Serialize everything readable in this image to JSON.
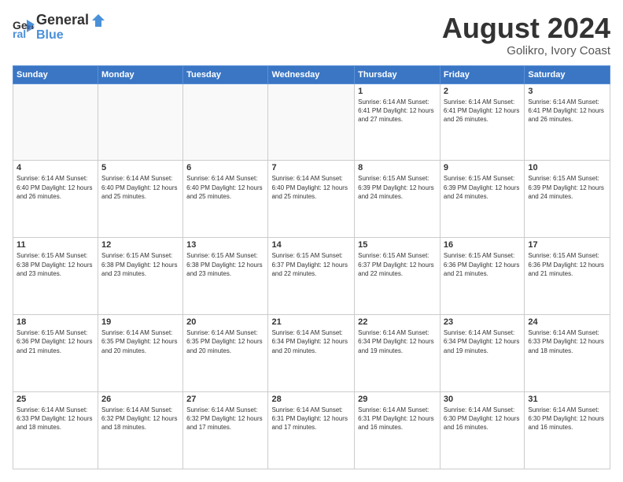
{
  "header": {
    "logo_line1": "General",
    "logo_line2": "Blue",
    "month_title": "August 2024",
    "location": "Golikro, Ivory Coast"
  },
  "days_of_week": [
    "Sunday",
    "Monday",
    "Tuesday",
    "Wednesday",
    "Thursday",
    "Friday",
    "Saturday"
  ],
  "weeks": [
    [
      {
        "day": "",
        "info": ""
      },
      {
        "day": "",
        "info": ""
      },
      {
        "day": "",
        "info": ""
      },
      {
        "day": "",
        "info": ""
      },
      {
        "day": "1",
        "info": "Sunrise: 6:14 AM\nSunset: 6:41 PM\nDaylight: 12 hours\nand 27 minutes."
      },
      {
        "day": "2",
        "info": "Sunrise: 6:14 AM\nSunset: 6:41 PM\nDaylight: 12 hours\nand 26 minutes."
      },
      {
        "day": "3",
        "info": "Sunrise: 6:14 AM\nSunset: 6:41 PM\nDaylight: 12 hours\nand 26 minutes."
      }
    ],
    [
      {
        "day": "4",
        "info": "Sunrise: 6:14 AM\nSunset: 6:40 PM\nDaylight: 12 hours\nand 26 minutes."
      },
      {
        "day": "5",
        "info": "Sunrise: 6:14 AM\nSunset: 6:40 PM\nDaylight: 12 hours\nand 25 minutes."
      },
      {
        "day": "6",
        "info": "Sunrise: 6:14 AM\nSunset: 6:40 PM\nDaylight: 12 hours\nand 25 minutes."
      },
      {
        "day": "7",
        "info": "Sunrise: 6:14 AM\nSunset: 6:40 PM\nDaylight: 12 hours\nand 25 minutes."
      },
      {
        "day": "8",
        "info": "Sunrise: 6:15 AM\nSunset: 6:39 PM\nDaylight: 12 hours\nand 24 minutes."
      },
      {
        "day": "9",
        "info": "Sunrise: 6:15 AM\nSunset: 6:39 PM\nDaylight: 12 hours\nand 24 minutes."
      },
      {
        "day": "10",
        "info": "Sunrise: 6:15 AM\nSunset: 6:39 PM\nDaylight: 12 hours\nand 24 minutes."
      }
    ],
    [
      {
        "day": "11",
        "info": "Sunrise: 6:15 AM\nSunset: 6:38 PM\nDaylight: 12 hours\nand 23 minutes."
      },
      {
        "day": "12",
        "info": "Sunrise: 6:15 AM\nSunset: 6:38 PM\nDaylight: 12 hours\nand 23 minutes."
      },
      {
        "day": "13",
        "info": "Sunrise: 6:15 AM\nSunset: 6:38 PM\nDaylight: 12 hours\nand 23 minutes."
      },
      {
        "day": "14",
        "info": "Sunrise: 6:15 AM\nSunset: 6:37 PM\nDaylight: 12 hours\nand 22 minutes."
      },
      {
        "day": "15",
        "info": "Sunrise: 6:15 AM\nSunset: 6:37 PM\nDaylight: 12 hours\nand 22 minutes."
      },
      {
        "day": "16",
        "info": "Sunrise: 6:15 AM\nSunset: 6:36 PM\nDaylight: 12 hours\nand 21 minutes."
      },
      {
        "day": "17",
        "info": "Sunrise: 6:15 AM\nSunset: 6:36 PM\nDaylight: 12 hours\nand 21 minutes."
      }
    ],
    [
      {
        "day": "18",
        "info": "Sunrise: 6:15 AM\nSunset: 6:36 PM\nDaylight: 12 hours\nand 21 minutes."
      },
      {
        "day": "19",
        "info": "Sunrise: 6:14 AM\nSunset: 6:35 PM\nDaylight: 12 hours\nand 20 minutes."
      },
      {
        "day": "20",
        "info": "Sunrise: 6:14 AM\nSunset: 6:35 PM\nDaylight: 12 hours\nand 20 minutes."
      },
      {
        "day": "21",
        "info": "Sunrise: 6:14 AM\nSunset: 6:34 PM\nDaylight: 12 hours\nand 20 minutes."
      },
      {
        "day": "22",
        "info": "Sunrise: 6:14 AM\nSunset: 6:34 PM\nDaylight: 12 hours\nand 19 minutes."
      },
      {
        "day": "23",
        "info": "Sunrise: 6:14 AM\nSunset: 6:34 PM\nDaylight: 12 hours\nand 19 minutes."
      },
      {
        "day": "24",
        "info": "Sunrise: 6:14 AM\nSunset: 6:33 PM\nDaylight: 12 hours\nand 18 minutes."
      }
    ],
    [
      {
        "day": "25",
        "info": "Sunrise: 6:14 AM\nSunset: 6:33 PM\nDaylight: 12 hours\nand 18 minutes."
      },
      {
        "day": "26",
        "info": "Sunrise: 6:14 AM\nSunset: 6:32 PM\nDaylight: 12 hours\nand 18 minutes."
      },
      {
        "day": "27",
        "info": "Sunrise: 6:14 AM\nSunset: 6:32 PM\nDaylight: 12 hours\nand 17 minutes."
      },
      {
        "day": "28",
        "info": "Sunrise: 6:14 AM\nSunset: 6:31 PM\nDaylight: 12 hours\nand 17 minutes."
      },
      {
        "day": "29",
        "info": "Sunrise: 6:14 AM\nSunset: 6:31 PM\nDaylight: 12 hours\nand 16 minutes."
      },
      {
        "day": "30",
        "info": "Sunrise: 6:14 AM\nSunset: 6:30 PM\nDaylight: 12 hours\nand 16 minutes."
      },
      {
        "day": "31",
        "info": "Sunrise: 6:14 AM\nSunset: 6:30 PM\nDaylight: 12 hours\nand 16 minutes."
      }
    ]
  ]
}
